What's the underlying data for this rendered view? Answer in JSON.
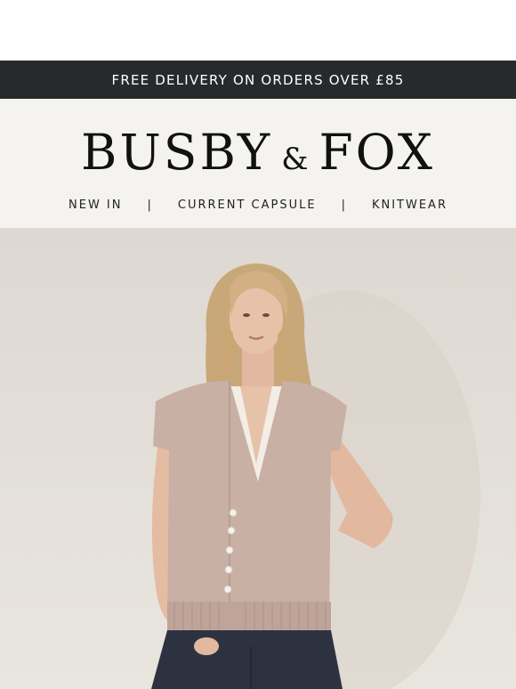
{
  "promo": {
    "text": "FREE DELIVERY ON ORDERS OVER £85"
  },
  "brand": {
    "name_left": "BUSBY",
    "ampersand": "&",
    "name_right": "FOX"
  },
  "nav": {
    "items": [
      {
        "label": "NEW IN"
      },
      {
        "label": "CURRENT CAPSULE"
      },
      {
        "label": "KNITWEAR"
      }
    ],
    "separator": "|"
  },
  "hero": {
    "image": "model-in-taupe-knit-waistcoat"
  }
}
